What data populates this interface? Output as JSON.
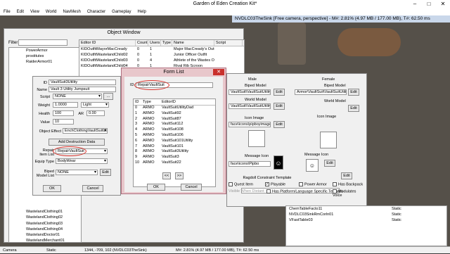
{
  "app": {
    "title": "Garden of Eden Creation Kit*"
  },
  "menu": [
    "File",
    "Edit",
    "View",
    "World",
    "NavMesh",
    "Character",
    "Gameplay",
    "Help"
  ],
  "render_window": {
    "title": "NVDLC03TheSink [Free camera, perspective] - M#: 2.81% (4.97 MB / 177.00 MB), T#: 62.50 ms"
  },
  "status_bar": {
    "left": "Camera",
    "mode": "Static",
    "coords": "1344, -709, 102 (NVDLC03TheSink)",
    "memory": "M#: 2.81% (4.97 MB / 177.00 MB), T#: 62.50 ms"
  },
  "object_window": {
    "title": "Object Window",
    "filter_label": "Filter",
    "tree_items": [
      "PowerArmor",
      "prostitutes",
      "RaiderArmor01",
      "",
      "",
      "",
      "",
      "",
      "",
      "",
      "",
      "",
      "",
      "",
      "",
      "",
      "",
      "",
      "",
      "",
      "",
      "",
      "",
      "",
      "",
      "",
      "",
      "",
      "WastelandClothing01",
      "WastelandClothing02",
      "WastelandClothing03",
      "WastelandClothing04",
      "WastelandDoctor01",
      "WastelandMerchant01"
    ],
    "columns": [
      "Editor ID",
      "Count",
      "Users",
      "Type",
      "Name",
      "Script"
    ],
    "rows": [
      {
        "id": "KIDOutfitMayorMacCready",
        "count": "0",
        "users": "1",
        "name": "Major MacCready's Outfit"
      },
      {
        "id": "KIDOutfitWastelandChild02",
        "count": "0",
        "users": "1",
        "name": "Junior Officer Outfit"
      },
      {
        "id": "KIDOutfitWastelandChild03",
        "count": "0",
        "users": "4",
        "name": "Athlete of the Wastes Outfit"
      },
      {
        "id": "KIDOutfitWastelandChild04",
        "count": "0",
        "users": "1",
        "name": "Rival Rib Scroon"
      }
    ]
  },
  "item_dialog": {
    "id_label": "ID",
    "id_value": "VaultSuit3Utility",
    "name_label": "Name",
    "name_value": "Vault 3 Utility Jumpsuit",
    "script_label": "Script",
    "script_value": "NONE",
    "weight_label": "Weight",
    "weight_value": "1.0000",
    "weight_class": "Light",
    "health_label": "Health",
    "health_value": "100",
    "ar_label": "AR",
    "ar_value": "0.00",
    "value_label": "Value",
    "value_value": "10",
    "object_effect_label": "Object Effect",
    "object_effect_value": "EnchClothingVaultSuitUtility",
    "add_destruction_label": "Add Destruction Data",
    "repair_label": "Repair Item List",
    "repair_value": "RepairVaultSuit",
    "equip_label": "Equip Type",
    "equip_value": "BodyWear",
    "biped_list_label": "Biped Model List",
    "biped_list_value": "NONE",
    "edit_label": "Edit",
    "ok_label": "OK",
    "cancel_label": "Cancel",
    "more_label": "..."
  },
  "form_list": {
    "title": "Form List",
    "id_label": "ID",
    "id_value": "RepairVaultSuit",
    "columns": [
      "ID",
      "Type",
      "EditorID"
    ],
    "rows": [
      {
        "n": "0",
        "type": "ARMO",
        "editor_id": "VaultSuitUtilityDad"
      },
      {
        "n": "1",
        "type": "ARMO",
        "editor_id": "VaultSuit92"
      },
      {
        "n": "2",
        "type": "ARMO",
        "editor_id": "VaultSuit87"
      },
      {
        "n": "3",
        "type": "ARMO",
        "editor_id": "VaultSuit112"
      },
      {
        "n": "4",
        "type": "ARMO",
        "editor_id": "VaultSuit108"
      },
      {
        "n": "5",
        "type": "ARMO",
        "editor_id": "VaultSuit106"
      },
      {
        "n": "6",
        "type": "ARMO",
        "editor_id": "VaultSuit101Utility"
      },
      {
        "n": "7",
        "type": "ARMO",
        "editor_id": "VaultSuit101"
      },
      {
        "n": "8",
        "type": "ARMO",
        "editor_id": "VaultSuit3Utility"
      },
      {
        "n": "9",
        "type": "ARMO",
        "editor_id": "VaultSuit3"
      },
      {
        "n": "10",
        "type": "ARMO",
        "editor_id": "VaultSuit22"
      }
    ],
    "prev_label": "<<",
    "next_label": ">>",
    "ok_label": "OK",
    "cancel_label": "Cancel"
  },
  "biped_panel": {
    "male_label": "Male",
    "female_label": "Female",
    "biped_model_label": "Biped Model",
    "world_model_label": "World Model",
    "icon_image_label": "Icon Image",
    "message_icon_label": "Message Icon",
    "male_biped_path": "VaultSuit\\VaultSuitUtility\\M\\OutfitM",
    "female_biped_path": "Armor\\VaultSuit\\VaultSuitUtility\\F\\OutfitF",
    "male_world_path": "VaultSuit\\VaultSuitUtility\\M\\GO.NIF",
    "male_icon_path": "face\\icons\\pipboyimages\\app",
    "male_msg_path": "face\\icons\\Pipbo",
    "edit_label": "Edit",
    "ragdoll_label": "Ragdoll Constraint Template",
    "quest_item_label": "Quest Item",
    "playable_label": "Playable",
    "power_armor_label": "Power Armor",
    "has_backpack_label": "Has Backpack",
    "has_platform_label": "Has Platform/Language Specific Textures",
    "modulates_voice_label": "Modulates Voice",
    "visible_when_distant_label": "Visible When Distant"
  },
  "render_list": [
    {
      "name": "ChemTableFacto11",
      "type": "Static"
    },
    {
      "name": "NVDLC03SinkRmCorln01",
      "type": "Static"
    },
    {
      "name": "VFastTable03",
      "type": "Static"
    }
  ],
  "colors": {
    "highlight": "#d9322a",
    "formlist_bg": "#e8c7cb",
    "close": "#c9302c"
  }
}
